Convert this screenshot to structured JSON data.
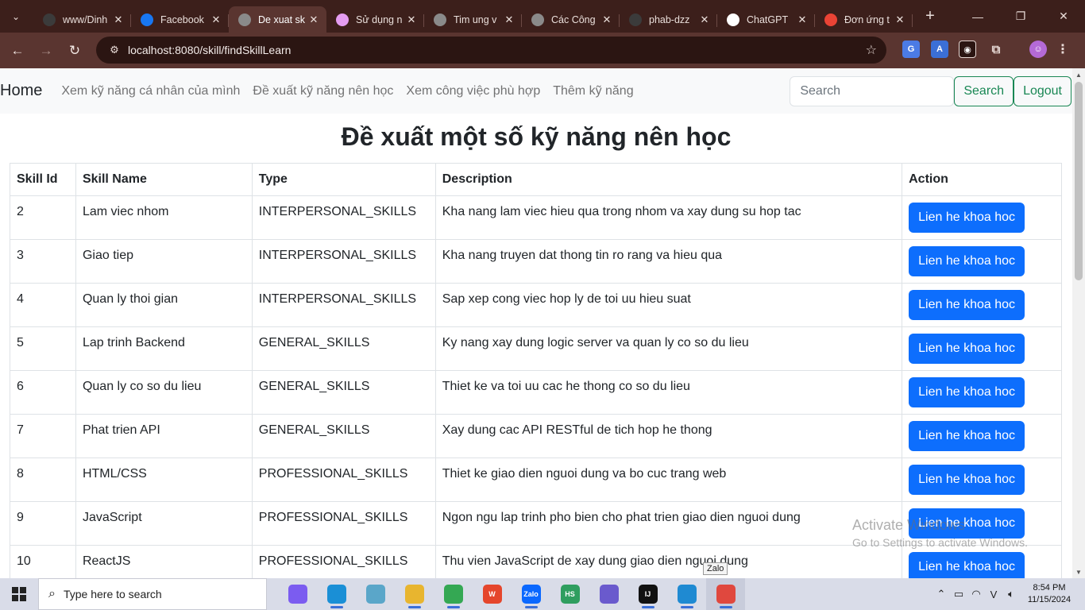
{
  "browser": {
    "tabs": [
      {
        "title": "www/Dinh",
        "favicon_color": "#3b3b3b",
        "active": false
      },
      {
        "title": "Facebook",
        "favicon_color": "#1877f2",
        "active": false
      },
      {
        "title": "De xuat sk",
        "favicon_color": "#8a8a8a",
        "active": true
      },
      {
        "title": "Sử dụng n",
        "favicon_color": "#e49cf0",
        "active": false
      },
      {
        "title": "Tim ung v",
        "favicon_color": "#8a8a8a",
        "active": false
      },
      {
        "title": "Các Công",
        "favicon_color": "#8a8a8a",
        "active": false
      },
      {
        "title": "phab-dzz",
        "favicon_color": "#3b3b3b",
        "active": false
      },
      {
        "title": "ChatGPT",
        "favicon_color": "#ffffff",
        "active": false
      },
      {
        "title": "Đơn ứng t",
        "favicon_color": "#ea4335",
        "active": false
      }
    ],
    "url": "localhost:8080/skill/findSkillLearn"
  },
  "navbar": {
    "brand": "Home",
    "links": [
      "Xem kỹ năng cá nhân của mình",
      "Đề xuất kỹ năng nên học",
      "Xem công việc phù hợp",
      "Thêm kỹ năng"
    ],
    "search_placeholder": "Search",
    "search_button": "Search",
    "logout_button": "Logout"
  },
  "page": {
    "title": "Đề xuất một số kỹ năng nên học",
    "columns": [
      "Skill Id",
      "Skill Name",
      "Type",
      "Description",
      "Action"
    ],
    "action_label": "Lien he khoa hoc",
    "rows": [
      {
        "id": "2",
        "name": "Lam viec nhom",
        "type": "INTERPERSONAL_SKILLS",
        "description": "Kha nang lam viec hieu qua trong nhom va xay dung su hop tac"
      },
      {
        "id": "3",
        "name": "Giao tiep",
        "type": "INTERPERSONAL_SKILLS",
        "description": "Kha nang truyen dat thong tin ro rang va hieu qua"
      },
      {
        "id": "4",
        "name": "Quan ly thoi gian",
        "type": "INTERPERSONAL_SKILLS",
        "description": "Sap xep cong viec hop ly de toi uu hieu suat"
      },
      {
        "id": "5",
        "name": "Lap trinh Backend",
        "type": "GENERAL_SKILLS",
        "description": "Ky nang xay dung logic server va quan ly co so du lieu"
      },
      {
        "id": "6",
        "name": "Quan ly co so du lieu",
        "type": "GENERAL_SKILLS",
        "description": "Thiet ke va toi uu cac he thong co so du lieu"
      },
      {
        "id": "7",
        "name": "Phat trien API",
        "type": "GENERAL_SKILLS",
        "description": "Xay dung cac API RESTful de tich hop he thong"
      },
      {
        "id": "8",
        "name": "HTML/CSS",
        "type": "PROFESSIONAL_SKILLS",
        "description": "Thiet ke giao dien nguoi dung va bo cuc trang web"
      },
      {
        "id": "9",
        "name": "JavaScript",
        "type": "PROFESSIONAL_SKILLS",
        "description": "Ngon ngu lap trinh pho bien cho phat trien giao dien nguoi dung"
      },
      {
        "id": "10",
        "name": "ReactJS",
        "type": "PROFESSIONAL_SKILLS",
        "description": "Thu vien JavaScript de xay dung giao dien nguoi dung"
      }
    ]
  },
  "overlay": {
    "watermark_line1": "Activate Windows",
    "watermark_line2": "Go to Settings to activate Windows.",
    "tooltip": "Zalo"
  },
  "taskbar": {
    "search_placeholder": "Type here to search",
    "apps": [
      {
        "name": "copilot-icon",
        "color": "#7b5cf0",
        "label": ""
      },
      {
        "name": "edge-icon",
        "color": "#1a8fd6",
        "label": ""
      },
      {
        "name": "files-icon",
        "color": "#5aa6c9",
        "label": ""
      },
      {
        "name": "file-explorer-icon",
        "color": "#e8b52f",
        "label": ""
      },
      {
        "name": "chrome-icon",
        "color": "#34a853",
        "label": ""
      },
      {
        "name": "wps-icon",
        "color": "#e5462c",
        "label": "W"
      },
      {
        "name": "zalo-icon",
        "color": "#0a68ff",
        "label": "Zalo"
      },
      {
        "name": "hs-icon",
        "color": "#2f9e5f",
        "label": "HS"
      },
      {
        "name": "photos-icon",
        "color": "#6a5acd",
        "label": ""
      },
      {
        "name": "intellij-icon",
        "color": "#111111",
        "label": "IJ"
      },
      {
        "name": "vscode-icon",
        "color": "#1f8ad2",
        "label": ""
      },
      {
        "name": "snipping-tool-icon",
        "color": "#e0483e",
        "label": ""
      }
    ],
    "time": "8:54 PM",
    "date": "11/15/2024"
  }
}
